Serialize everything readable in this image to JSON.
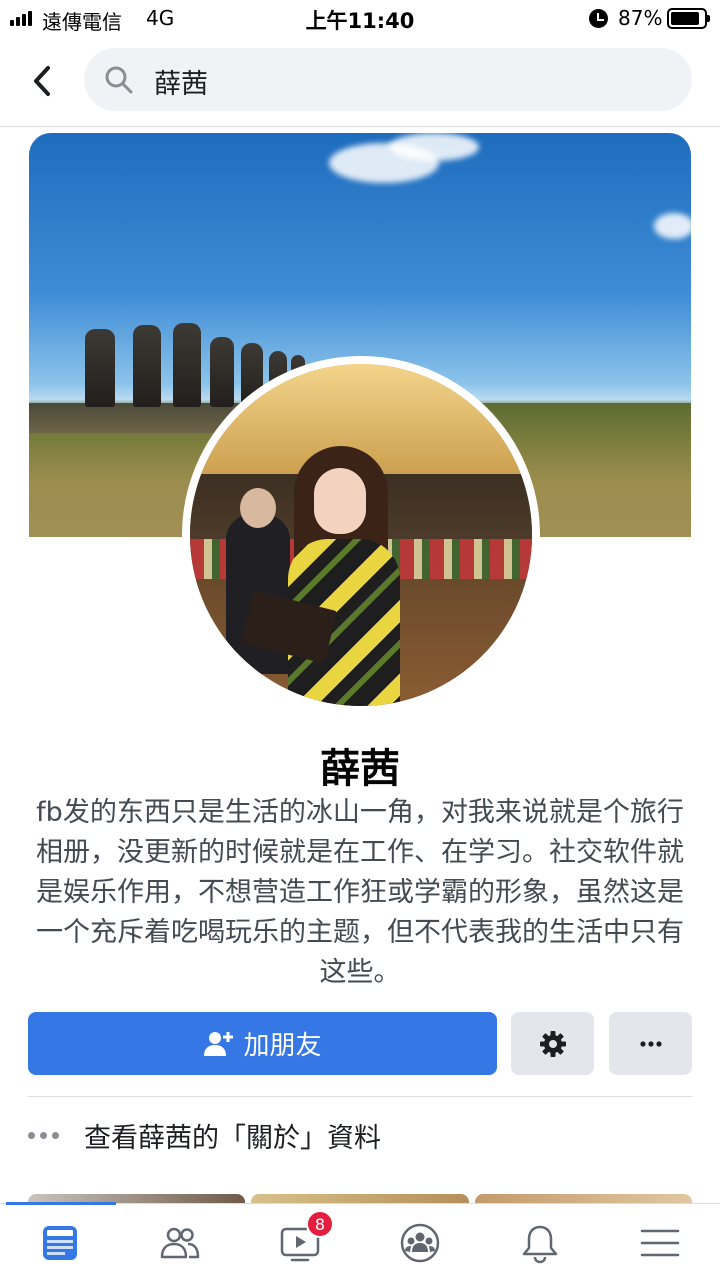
{
  "status_bar": {
    "carrier": "遠傳電信",
    "network": "4G",
    "time": "上午11:40",
    "battery_percent": "87%",
    "battery_level": 0.87,
    "icons": [
      "signal-icon",
      "alarm-icon",
      "battery-icon"
    ]
  },
  "header": {
    "back_icon": "chevron-left-icon",
    "search_query": "薛茜",
    "search_icon": "search-icon"
  },
  "profile": {
    "name": "薛茜",
    "bio": "fb发的东西只是生活的冰山一角，对我来说就是个旅行相册，没更新的时候就是在工作、在学习。社交软件就是娱乐作用，不想营造工作狂或学霸的形象，虽然这是一个充斥着吃喝玩乐的主题，但不代表我的生活中只有这些。"
  },
  "actions": {
    "add_friend_label": "加朋友",
    "add_friend_icon": "person-plus-icon",
    "settings_icon": "gear-icon",
    "more_icon": "more-horizontal-icon"
  },
  "about": {
    "label": "查看薛茜的「關於」資料",
    "icon": "more-dots-icon"
  },
  "tab_bar": {
    "tabs": [
      {
        "name": "news-feed",
        "icon": "news-feed-icon",
        "active": true
      },
      {
        "name": "friends",
        "icon": "friends-icon",
        "active": false
      },
      {
        "name": "watch",
        "icon": "video-icon",
        "active": false,
        "badge": "8"
      },
      {
        "name": "groups",
        "icon": "groups-icon",
        "active": false
      },
      {
        "name": "notifications",
        "icon": "bell-icon",
        "active": false
      },
      {
        "name": "menu",
        "icon": "menu-icon",
        "active": false
      }
    ]
  },
  "colors": {
    "accent": "#3578e5",
    "badge": "#e41e3f",
    "secondary_button": "#e4e6eb",
    "search_background": "#f0f2f5"
  }
}
